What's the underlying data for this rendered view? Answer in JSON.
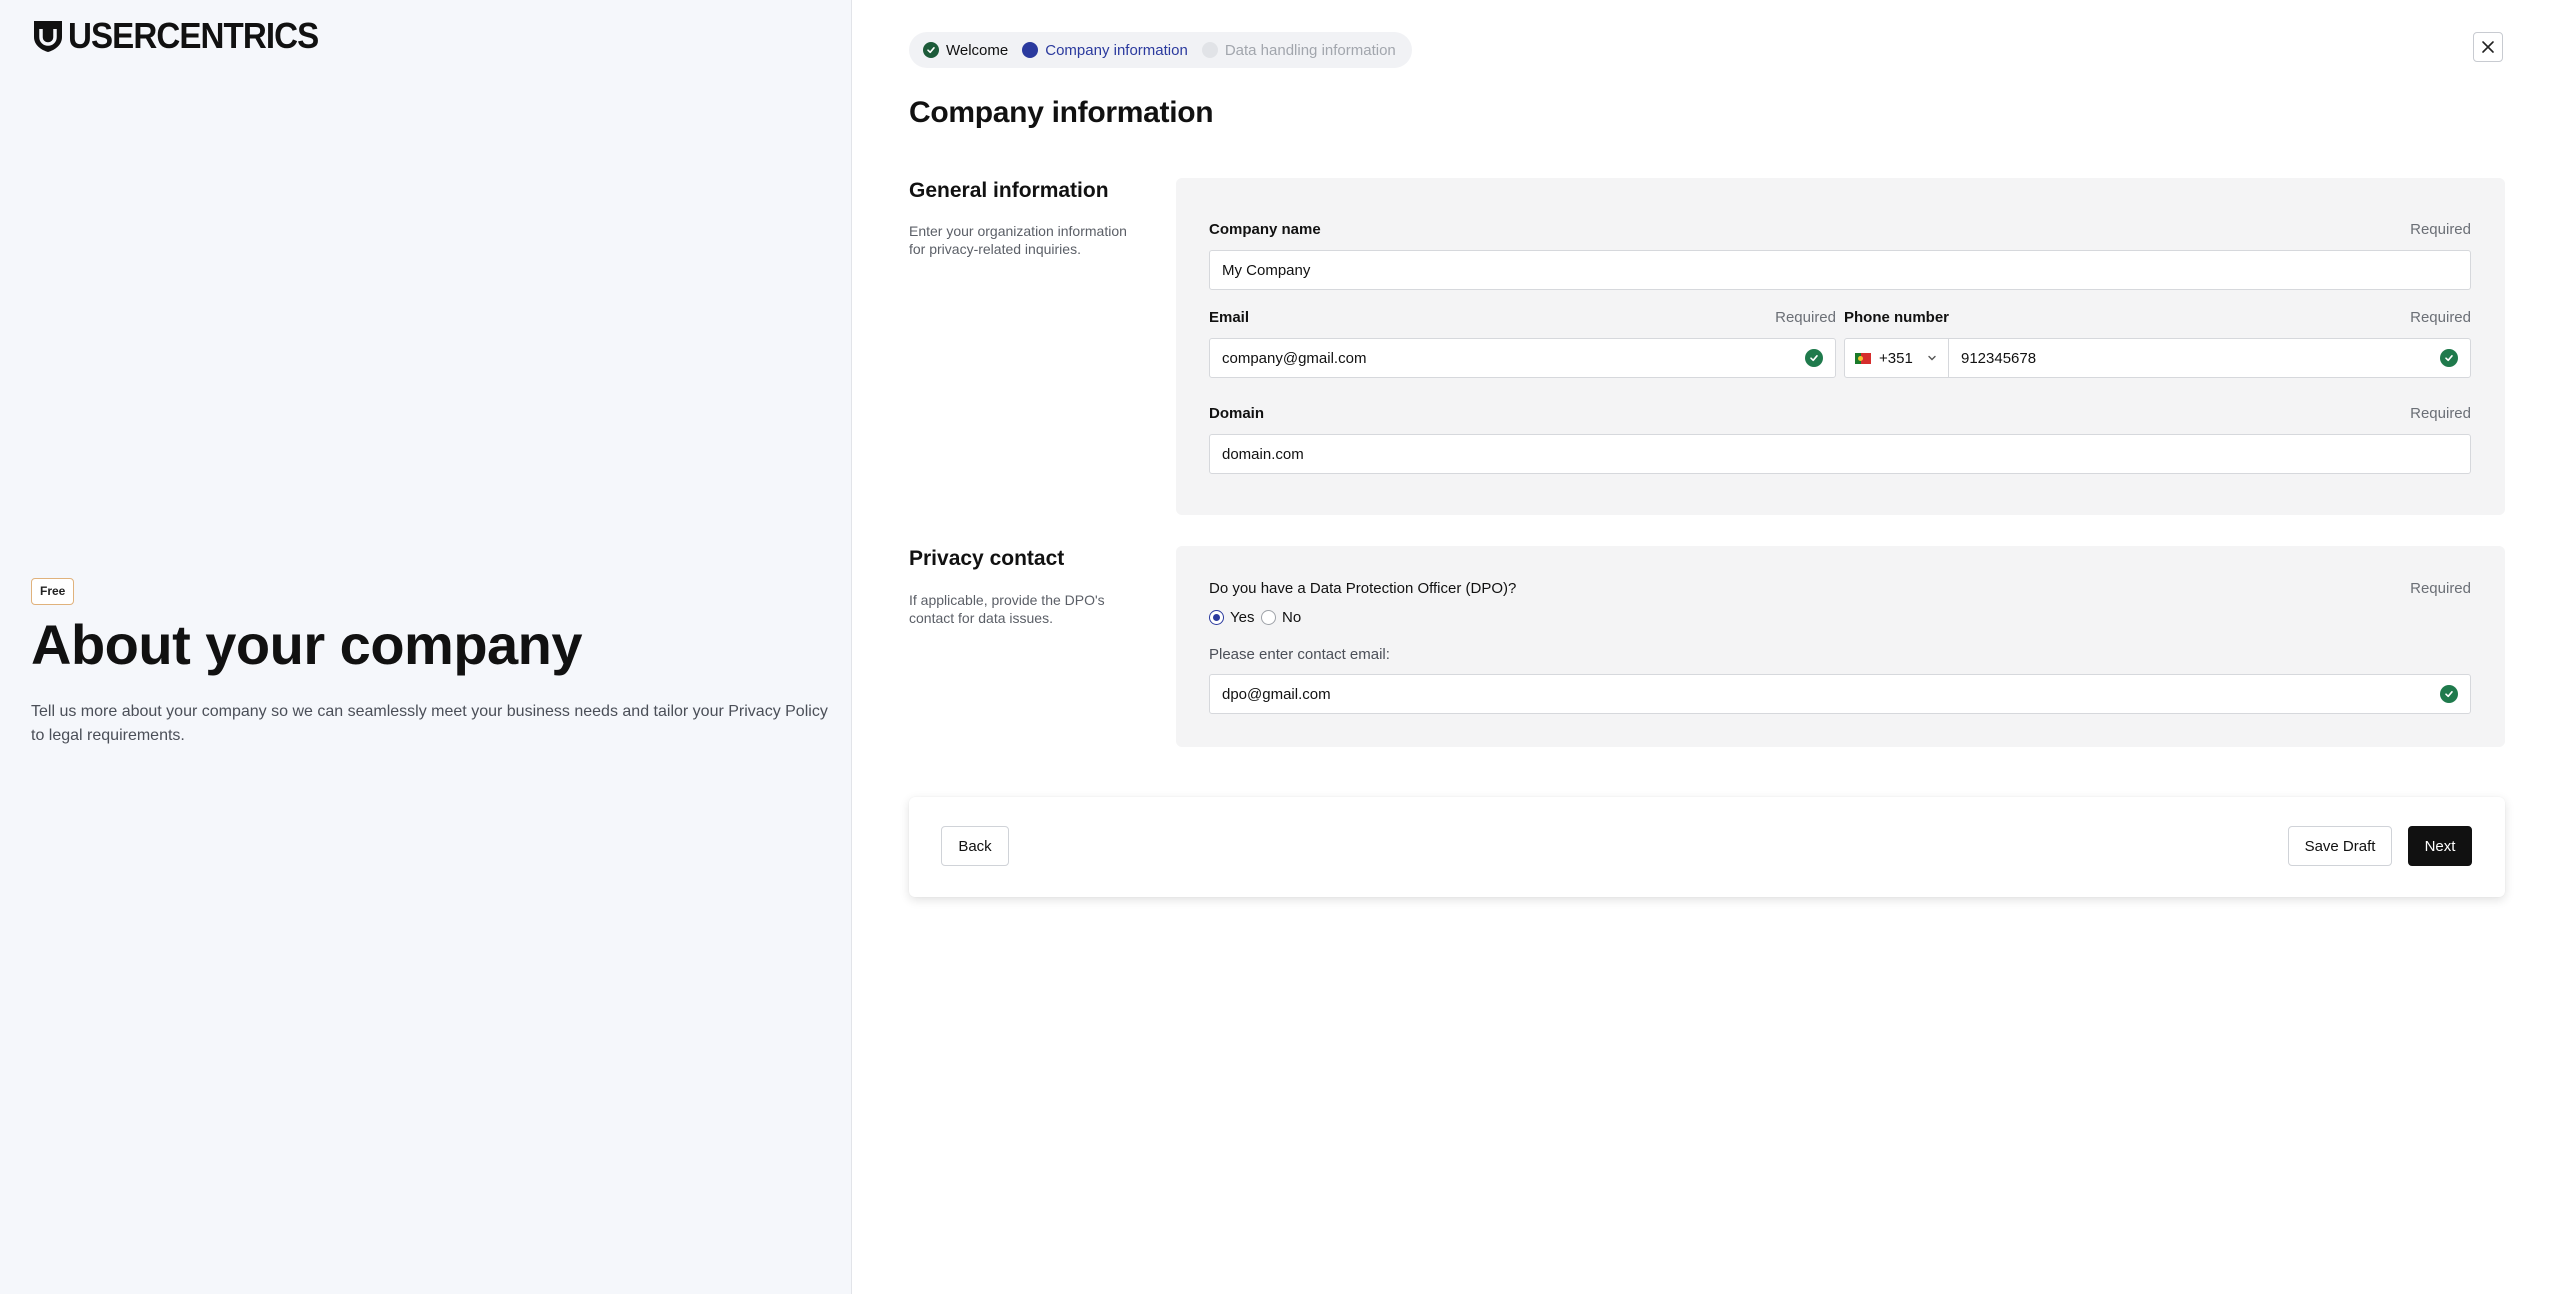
{
  "brand": {
    "name": "USERCENTRICS"
  },
  "left": {
    "badge": "Free",
    "title": "About your company",
    "description": "Tell us more about your company so we can seamlessly meet your business needs and tailor your Privacy Policy to legal requirements."
  },
  "stepper": {
    "steps": [
      {
        "label": "Welcome",
        "state": "done"
      },
      {
        "label": "Company information",
        "state": "active"
      },
      {
        "label": "Data handling information",
        "state": "pending"
      }
    ]
  },
  "page": {
    "title": "Company information"
  },
  "general": {
    "title": "General information",
    "description": "Enter your organization information for privacy-related inquiries.",
    "company_name": {
      "label": "Company name",
      "required": "Required",
      "value": "My Company"
    },
    "email": {
      "label": "Email",
      "required": "Required",
      "value": "company@gmail.com"
    },
    "phone": {
      "label": "Phone number",
      "required": "Required",
      "country_code": "+351",
      "value": "912345678"
    },
    "domain": {
      "label": "Domain",
      "required": "Required",
      "value": "domain.com"
    }
  },
  "privacy": {
    "title": "Privacy contact",
    "description": "If applicable, provide the DPO's contact for data issues.",
    "question": "Do you have a Data Protection Officer (DPO)?",
    "required": "Required",
    "options": {
      "yes": "Yes",
      "no": "No"
    },
    "selected": "yes",
    "contact_label": "Please enter contact email:",
    "contact_value": "dpo@gmail.com"
  },
  "footer": {
    "back_label": "Back",
    "save_label": "Save Draft",
    "next_label": "Next"
  },
  "colors": {
    "accent": "#2b3a9e",
    "success": "#1f7a4c",
    "primary_button": "#111111",
    "badge_border": "#e0b27c"
  },
  "icons": {
    "logo": "usercentrics-shield-icon",
    "close": "close-icon",
    "valid": "check-circle-icon",
    "dropdown": "chevron-down-icon",
    "flag": "portugal-flag-icon"
  }
}
